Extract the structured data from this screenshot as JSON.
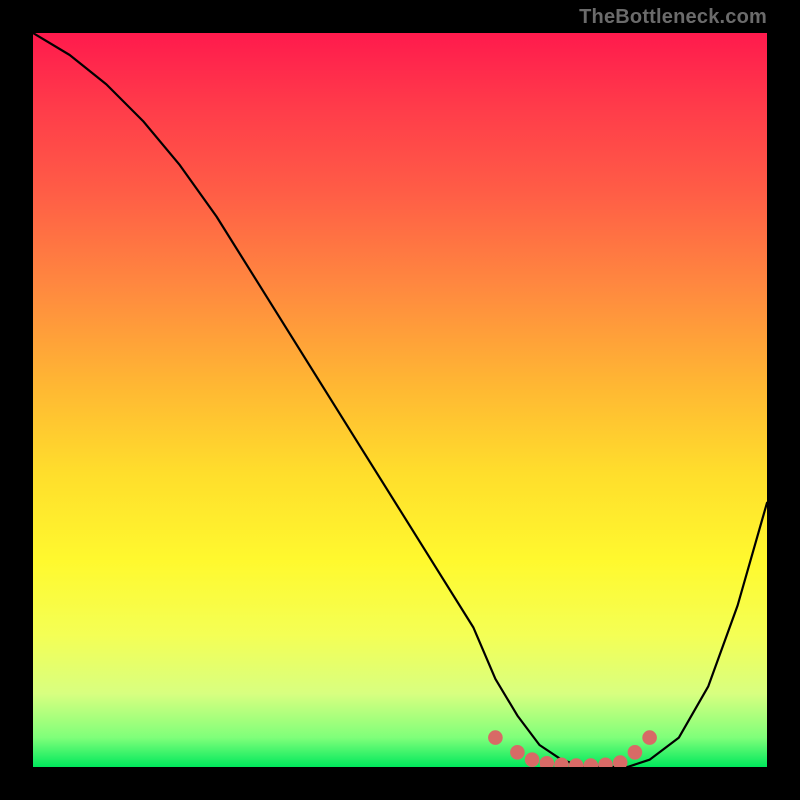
{
  "watermark": "TheBottleneck.com",
  "chart_data": {
    "type": "line",
    "title": "",
    "xlabel": "",
    "ylabel": "",
    "xlim": [
      0,
      100
    ],
    "ylim": [
      0,
      100
    ],
    "grid": false,
    "legend": false,
    "series": [
      {
        "name": "curve",
        "color": "#000000",
        "x": [
          0,
          5,
          10,
          15,
          20,
          25,
          30,
          35,
          40,
          45,
          50,
          55,
          60,
          63,
          66,
          69,
          72,
          75,
          78,
          81,
          84,
          88,
          92,
          96,
          100
        ],
        "y": [
          100,
          97,
          93,
          88,
          82,
          75,
          67,
          59,
          51,
          43,
          35,
          27,
          19,
          12,
          7,
          3,
          1,
          0,
          0,
          0,
          1,
          4,
          11,
          22,
          36
        ]
      }
    ],
    "markers": {
      "name": "flat-region-dots",
      "color": "#d86a66",
      "radius": 1.0,
      "x": [
        63,
        66,
        68,
        70,
        72,
        74,
        76,
        78,
        80,
        82,
        84
      ],
      "y": [
        4,
        2,
        1,
        0.5,
        0.3,
        0.2,
        0.2,
        0.3,
        0.6,
        2,
        4
      ]
    },
    "background_gradient_stops": [
      {
        "pos": 0,
        "color": "#ff1a4d"
      },
      {
        "pos": 10,
        "color": "#ff3b4a"
      },
      {
        "pos": 22,
        "color": "#ff5e46"
      },
      {
        "pos": 35,
        "color": "#ff8a3f"
      },
      {
        "pos": 48,
        "color": "#ffb733"
      },
      {
        "pos": 60,
        "color": "#ffde2c"
      },
      {
        "pos": 72,
        "color": "#fff92e"
      },
      {
        "pos": 82,
        "color": "#f4ff55"
      },
      {
        "pos": 90,
        "color": "#d8ff80"
      },
      {
        "pos": 96,
        "color": "#7fff7a"
      },
      {
        "pos": 100,
        "color": "#00e85c"
      }
    ]
  }
}
